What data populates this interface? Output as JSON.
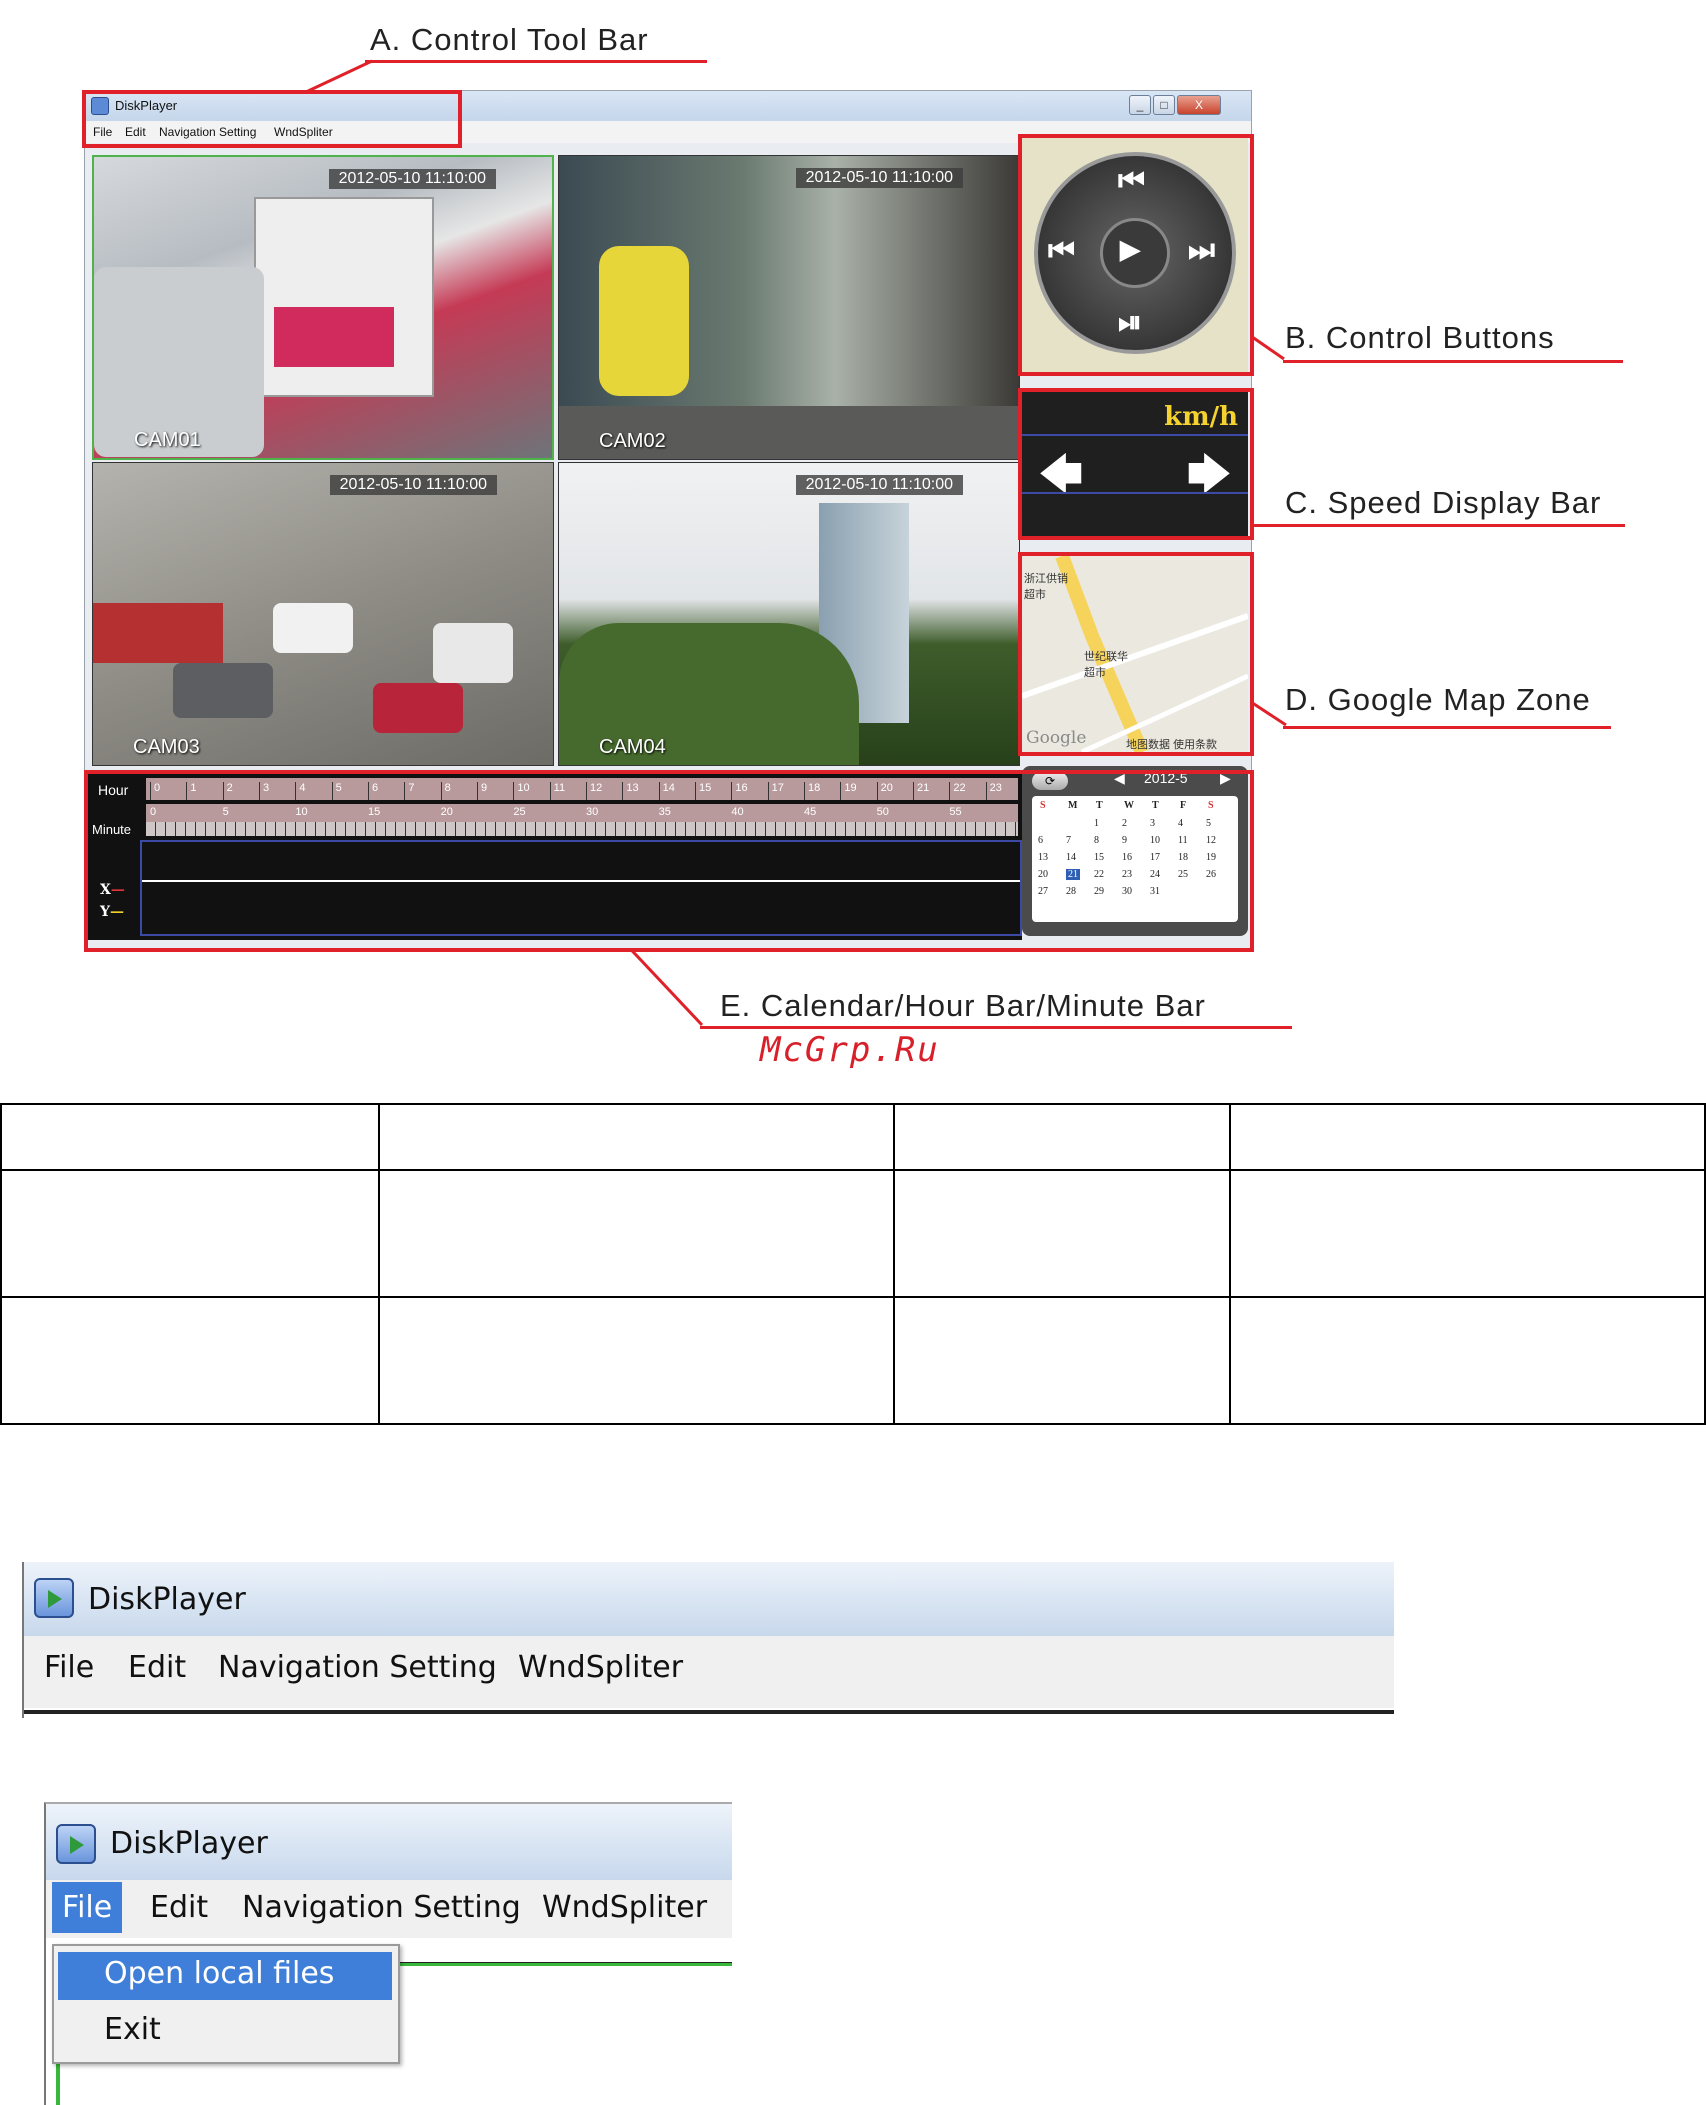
{
  "callouts": {
    "a": "A. Control Tool Bar",
    "b": "B. Control Buttons",
    "c": "C. Speed Display Bar",
    "d": "D. Google Map Zone",
    "e": "E. Calendar/Hour Bar/Minute Bar"
  },
  "watermark": "McGrp.Ru",
  "window": {
    "title": "DiskPlayer",
    "menu": [
      "File",
      "Edit",
      "Navigation Setting",
      "WndSpliter"
    ],
    "controls": [
      "_",
      "□",
      "X"
    ]
  },
  "cameras": [
    {
      "label": "CAM01",
      "timestamp": "2012-05-10 11:10:00"
    },
    {
      "label": "CAM02",
      "timestamp": "2012-05-10 11:10:00"
    },
    {
      "label": "CAM03",
      "timestamp": "2012-05-10 11:10:00"
    },
    {
      "label": "CAM04",
      "timestamp": "2012-05-10 11:10:00"
    }
  ],
  "speed": {
    "unit": "km/h"
  },
  "map": {
    "label1": "浙江供销超市",
    "label2": "世纪联华超市",
    "google": "Google",
    "links": "地图数据  使用条款"
  },
  "timeline": {
    "hour_label": "Hour",
    "minute_label": "Minute",
    "hours": [
      "0",
      "1",
      "2",
      "3",
      "4",
      "5",
      "6",
      "7",
      "8",
      "9",
      "10",
      "11",
      "12",
      "13",
      "14",
      "15",
      "16",
      "17",
      "18",
      "19",
      "20",
      "21",
      "22",
      "23"
    ],
    "minutes": [
      "0",
      "5",
      "10",
      "15",
      "20",
      "25",
      "30",
      "35",
      "40",
      "45",
      "50",
      "55"
    ],
    "x_label": "X",
    "y_label": "Y"
  },
  "calendar": {
    "month": "2012-5",
    "weekdays": [
      "S",
      "M",
      "T",
      "W",
      "T",
      "F",
      "S"
    ],
    "rows": [
      [
        "",
        "",
        "1",
        "2",
        "3",
        "4",
        "5"
      ],
      [
        "6",
        "7",
        "8",
        "9",
        "10",
        "11",
        "12"
      ],
      [
        "13",
        "14",
        "15",
        "16",
        "17",
        "18",
        "19"
      ],
      [
        "20",
        "21",
        "22",
        "23",
        "24",
        "25",
        "26"
      ],
      [
        "27",
        "28",
        "29",
        "30",
        "31",
        "",
        ""
      ]
    ],
    "selected": "21"
  },
  "zoom1": {
    "title": "DiskPlayer",
    "menu": [
      "File",
      "Edit",
      "Navigation Setting",
      "WndSpliter"
    ]
  },
  "zoom2": {
    "title": "DiskPlayer",
    "menu": [
      "File",
      "Edit",
      "Navigation Setting",
      "WndSpliter"
    ],
    "dropdown": [
      "Open local files",
      "Exit"
    ]
  }
}
